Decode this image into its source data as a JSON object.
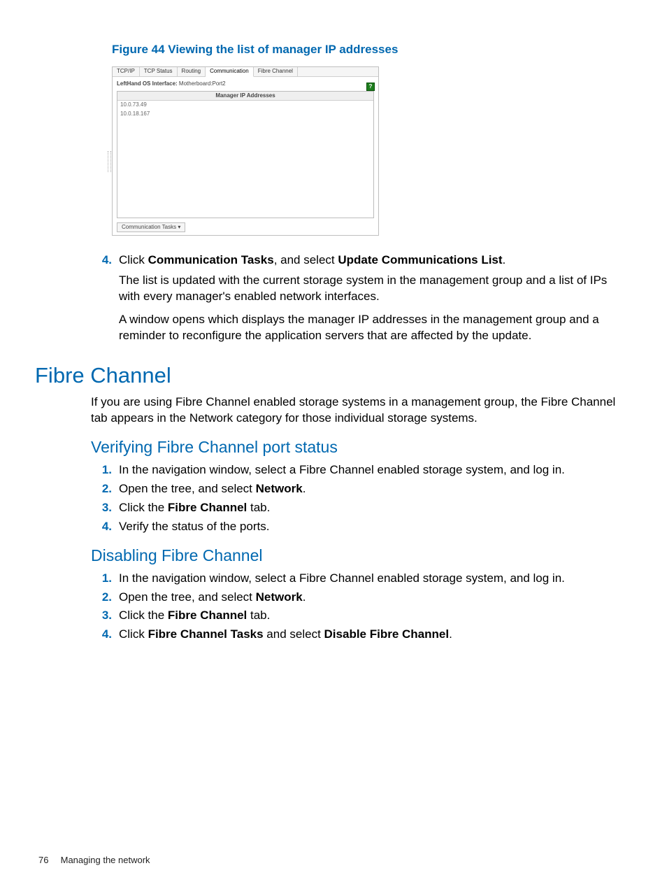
{
  "figure": {
    "caption": "Figure 44 Viewing the list of manager IP addresses",
    "tabs": [
      "TCP/IP",
      "TCP Status",
      "Routing",
      "Communication",
      "Fibre Channel"
    ],
    "active_tab_index": 3,
    "interface_label": "LeftHand OS Interface:",
    "interface_value": "Motherboard:Port2",
    "help_icon": "?",
    "list_header": "Manager IP Addresses",
    "list_rows": [
      "10.0.73.49",
      "10.0.18.167"
    ],
    "tasks_button": "Communication Tasks"
  },
  "step4": {
    "num": "4.",
    "main_pre": "Click ",
    "main_b1": "Communication Tasks",
    "main_mid": ", and select ",
    "main_b2": "Update Communications List",
    "main_post": ".",
    "sub1": "The list is updated with the current storage system in the management group and a list of IPs with every manager's enabled network interfaces.",
    "sub2": "A window opens which displays the manager IP addresses in the management group and a reminder to reconfigure the application servers that are affected by the update."
  },
  "h1": "Fibre Channel",
  "h1_para": "If you are using Fibre Channel enabled storage systems in a management group, the Fibre Channel tab appears in the Network category for those individual storage systems.",
  "verify": {
    "heading": "Verifying Fibre Channel port status",
    "steps": [
      {
        "num": "1.",
        "pre": "In the navigation window, select a Fibre Channel enabled storage system, and log in."
      },
      {
        "num": "2.",
        "pre": "Open the tree, and select ",
        "b1": "Network",
        "post": "."
      },
      {
        "num": "3.",
        "pre": "Click the ",
        "b1": "Fibre Channel",
        "post": " tab."
      },
      {
        "num": "4.",
        "pre": "Verify the status of the ports."
      }
    ]
  },
  "disable": {
    "heading": "Disabling Fibre Channel",
    "steps": [
      {
        "num": "1.",
        "pre": "In the navigation window, select a Fibre Channel enabled storage system, and log in."
      },
      {
        "num": "2.",
        "pre": "Open the tree, and select ",
        "b1": "Network",
        "post": "."
      },
      {
        "num": "3.",
        "pre": "Click the ",
        "b1": "Fibre Channel",
        "post": " tab."
      },
      {
        "num": "4.",
        "pre": "Click ",
        "b1": "Fibre Channel Tasks",
        "mid": " and select ",
        "b2": "Disable Fibre Channel",
        "post": "."
      }
    ]
  },
  "footer": {
    "page": "76",
    "title": "Managing the network"
  }
}
